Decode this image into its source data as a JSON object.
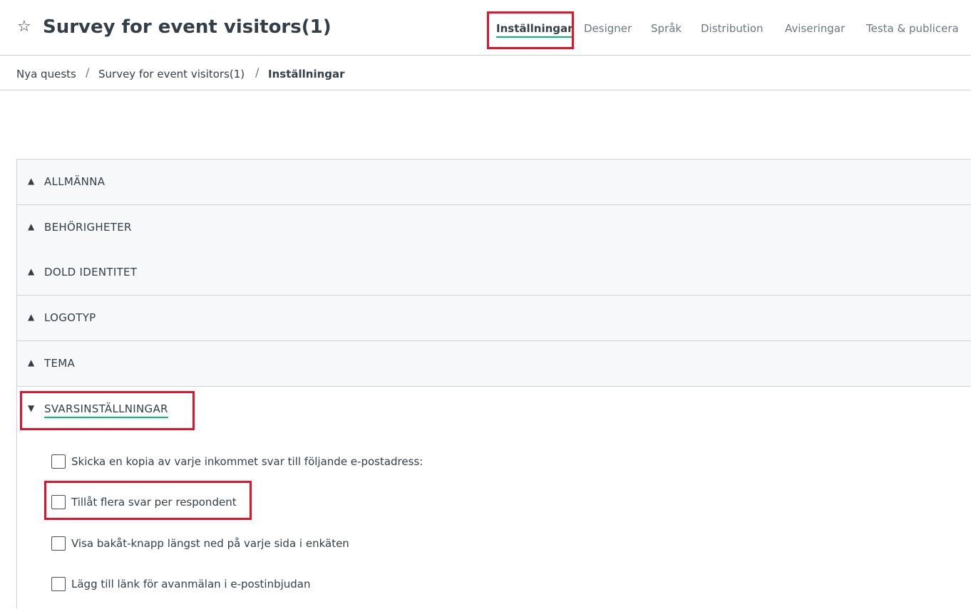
{
  "header": {
    "title": "Survey for event visitors(1)",
    "star_icon": "star-outline-icon"
  },
  "tabs": [
    {
      "label": "Inställningar",
      "active": true
    },
    {
      "label": "Designer"
    },
    {
      "label": "Språk"
    },
    {
      "label": "Distribution"
    },
    {
      "label": "Aviseringar"
    },
    {
      "label": "Testa & publicera"
    }
  ],
  "breadcrumb": {
    "items": [
      "Nya quests",
      "Survey for event visitors(1)",
      "Inställningar"
    ],
    "separator": "/"
  },
  "accordion": {
    "sections": [
      {
        "label": "ALLMÄNNA",
        "arrow": "▲"
      },
      {
        "label": "BEHÖRIGHETER",
        "arrow": "▲"
      },
      {
        "label": "DOLD IDENTITET",
        "arrow": "▲"
      },
      {
        "label": "LOGOTYP",
        "arrow": "▲"
      },
      {
        "label": "TEMA",
        "arrow": "▲"
      },
      {
        "label": "SVARSINSTÄLLNINGAR",
        "arrow": "▼",
        "expanded": true
      }
    ],
    "options": [
      {
        "label": "Skicka en kopia av varje inkommet svar till följande e-postadress:",
        "checked": false
      },
      {
        "label": "Tillåt flera svar per respondent",
        "checked": false
      },
      {
        "label": "Visa bakåt-knapp längst ned på varje sida i enkäten",
        "checked": false
      },
      {
        "label": "Lägg till länk för avanmälan i e-postinbjudan",
        "checked": false
      }
    ]
  },
  "colors": {
    "accent": "#00bf6f",
    "highlight": "#e0142a",
    "text": "#333e48",
    "muted": "#6b787f",
    "panel_bg": "#f7f8fa",
    "border": "#d0d2d3"
  }
}
